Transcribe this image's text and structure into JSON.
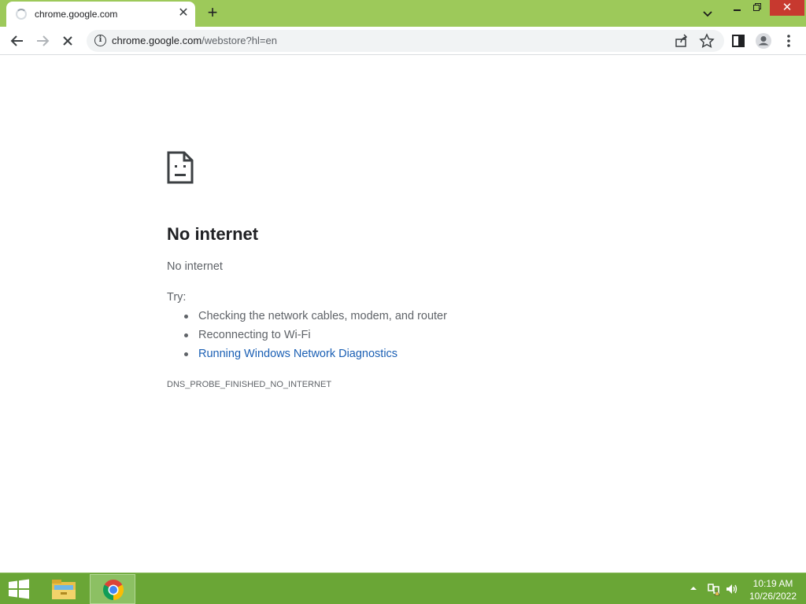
{
  "browser": {
    "tab": {
      "title": "chrome.google.com"
    },
    "new_tab_label": "+",
    "tab_close_label": "✕",
    "window_close_label": "✕",
    "address": {
      "host": "chrome.google.com",
      "path": "/webstore?hl=en"
    }
  },
  "error_page": {
    "title": "No internet",
    "subtitle": "No internet",
    "try_label": "Try:",
    "suggestions": [
      "Checking the network cables, modem, and router",
      "Reconnecting to Wi-Fi"
    ],
    "diagnostics_link": "Running Windows Network Diagnostics",
    "error_code": "DNS_PROBE_FINISHED_NO_INTERNET"
  },
  "taskbar": {
    "apps": [
      "start-button",
      "file-explorer",
      "chrome"
    ],
    "clock": {
      "time": "10:19 AM",
      "date": "10/26/2022"
    }
  },
  "colors": {
    "frame": "#9dc95a",
    "taskbar": "#6aa636",
    "link": "#1a5fb4",
    "close_button": "#c7392f"
  }
}
